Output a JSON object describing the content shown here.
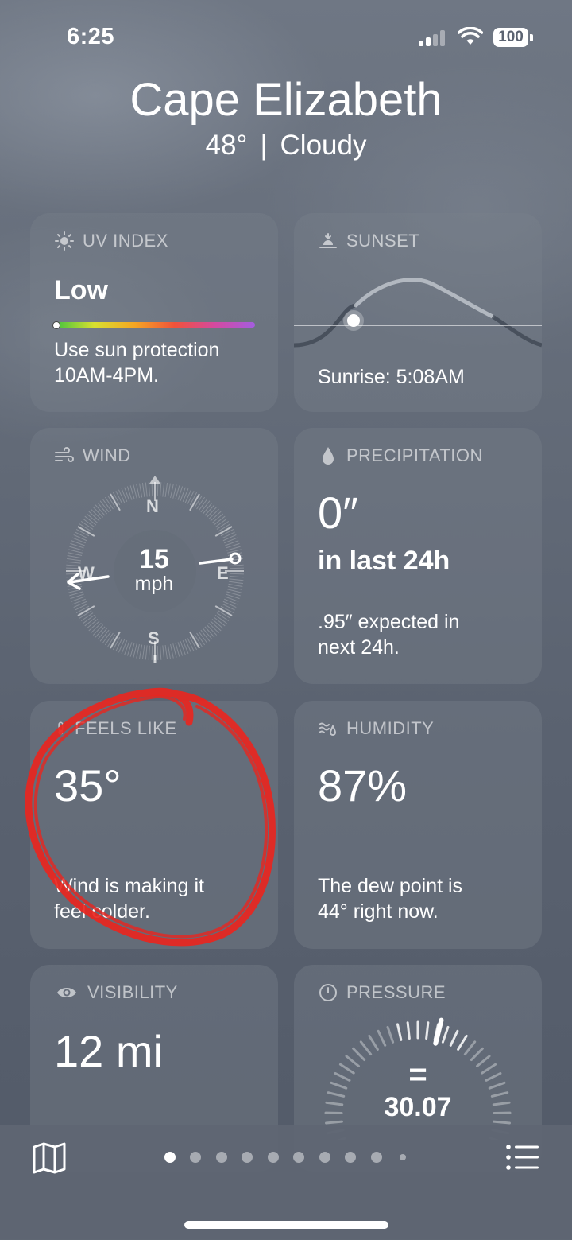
{
  "status": {
    "time": "6:25",
    "battery": "100"
  },
  "header": {
    "city": "Cape Elizabeth",
    "temp": "48°",
    "separator": "|",
    "condition": "Cloudy"
  },
  "uv": {
    "title": "UV INDEX",
    "level": "Low",
    "desc_line1": "Use sun protection",
    "desc_line2": "10AM-4PM.",
    "value_fraction": 0.0
  },
  "sunset": {
    "title": "SUNSET",
    "sunrise_text": "Sunrise: 5:08AM"
  },
  "wind": {
    "title": "WIND",
    "speed": "15",
    "unit": "mph",
    "n": "N",
    "s": "S",
    "e": "E",
    "w": "W",
    "direction": "E"
  },
  "precipitation": {
    "title": "PRECIPITATION",
    "amount": "0″",
    "period": "in last 24h",
    "desc_line1": ".95″ expected in",
    "desc_line2": "next 24h."
  },
  "feels_like": {
    "title": "FEELS LIKE",
    "value": "35°",
    "desc_line1": "Wind is making it",
    "desc_line2": "feel colder."
  },
  "humidity": {
    "title": "HUMIDITY",
    "value": "87%",
    "desc_line1": "The dew point is",
    "desc_line2": "44° right now."
  },
  "visibility": {
    "title": "VISIBILITY",
    "value": "12 mi"
  },
  "pressure": {
    "title": "PRESSURE",
    "value": "30.07",
    "trend_symbol": "="
  },
  "tabbar": {
    "map_icon": "map-icon",
    "list_icon": "list-icon",
    "page_count": 10,
    "current_page": 1
  },
  "colors": {
    "annotation": "#e8261f",
    "card_bg": "rgba(120,128,140,0.38)"
  }
}
